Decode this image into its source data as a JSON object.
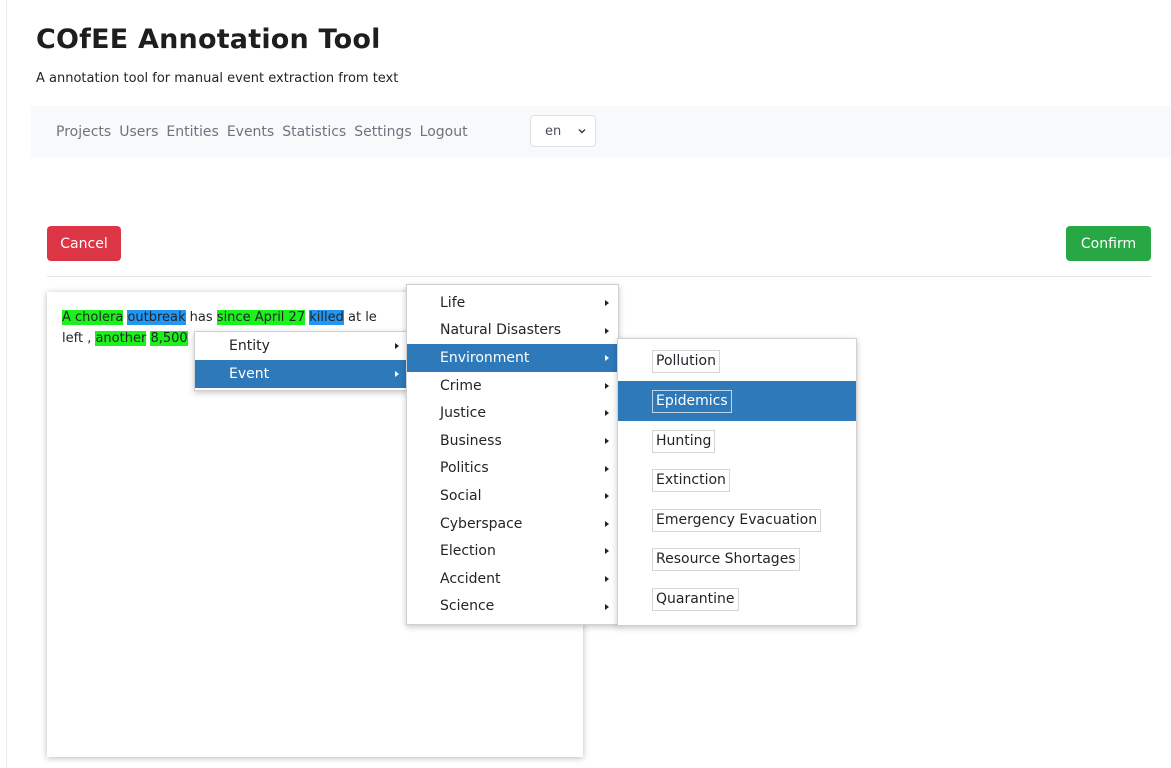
{
  "app": {
    "title": "COfEE Annotation Tool",
    "subtitle": "A annotation tool for manual event extraction from text"
  },
  "nav": {
    "links": [
      "Projects",
      "Users",
      "Entities",
      "Events",
      "Statistics",
      "Settings",
      "Logout"
    ],
    "language": "en"
  },
  "actions": {
    "cancel_label": "Cancel",
    "confirm_label": "Confirm"
  },
  "document": {
    "line1": [
      {
        "text": "A cholera",
        "highlight": "green"
      },
      {
        "text": "outbreak",
        "highlight": "blue"
      },
      {
        "text": "has",
        "highlight": "none"
      },
      {
        "text": "since April 27",
        "highlight": "green"
      },
      {
        "text": "killed",
        "highlight": "blue"
      },
      {
        "text": "at le",
        "highlight": "none"
      }
    ],
    "line2": [
      {
        "text": "left ,",
        "highlight": "none"
      },
      {
        "text": "another",
        "highlight": "green"
      },
      {
        "text": "8,500",
        "highlight": "green"
      }
    ]
  },
  "context_menu": {
    "level1": [
      {
        "label": "Entity",
        "active": false
      },
      {
        "label": "Event",
        "active": true
      }
    ],
    "level2": [
      {
        "label": "Life",
        "active": false
      },
      {
        "label": "Natural Disasters",
        "active": false
      },
      {
        "label": "Environment",
        "active": true
      },
      {
        "label": "Crime",
        "active": false
      },
      {
        "label": "Justice",
        "active": false
      },
      {
        "label": "Business",
        "active": false
      },
      {
        "label": "Politics",
        "active": false
      },
      {
        "label": "Social",
        "active": false
      },
      {
        "label": "Cyberspace",
        "active": false
      },
      {
        "label": "Election",
        "active": false
      },
      {
        "label": "Accident",
        "active": false
      },
      {
        "label": "Science",
        "active": false
      }
    ],
    "level3": [
      {
        "label": "Pollution",
        "active": false
      },
      {
        "label": "Epidemics",
        "active": true
      },
      {
        "label": "Hunting",
        "active": false
      },
      {
        "label": "Extinction",
        "active": false
      },
      {
        "label": "Emergency Evacuation",
        "active": false
      },
      {
        "label": "Resource Shortages",
        "active": false
      },
      {
        "label": "Quarantine",
        "active": false
      }
    ]
  },
  "colors": {
    "cancel": "#dc3545",
    "confirm": "#28a745",
    "menu_active": "#2e79b9",
    "highlight_green": "#1cf11c",
    "highlight_blue": "#2196f3"
  }
}
